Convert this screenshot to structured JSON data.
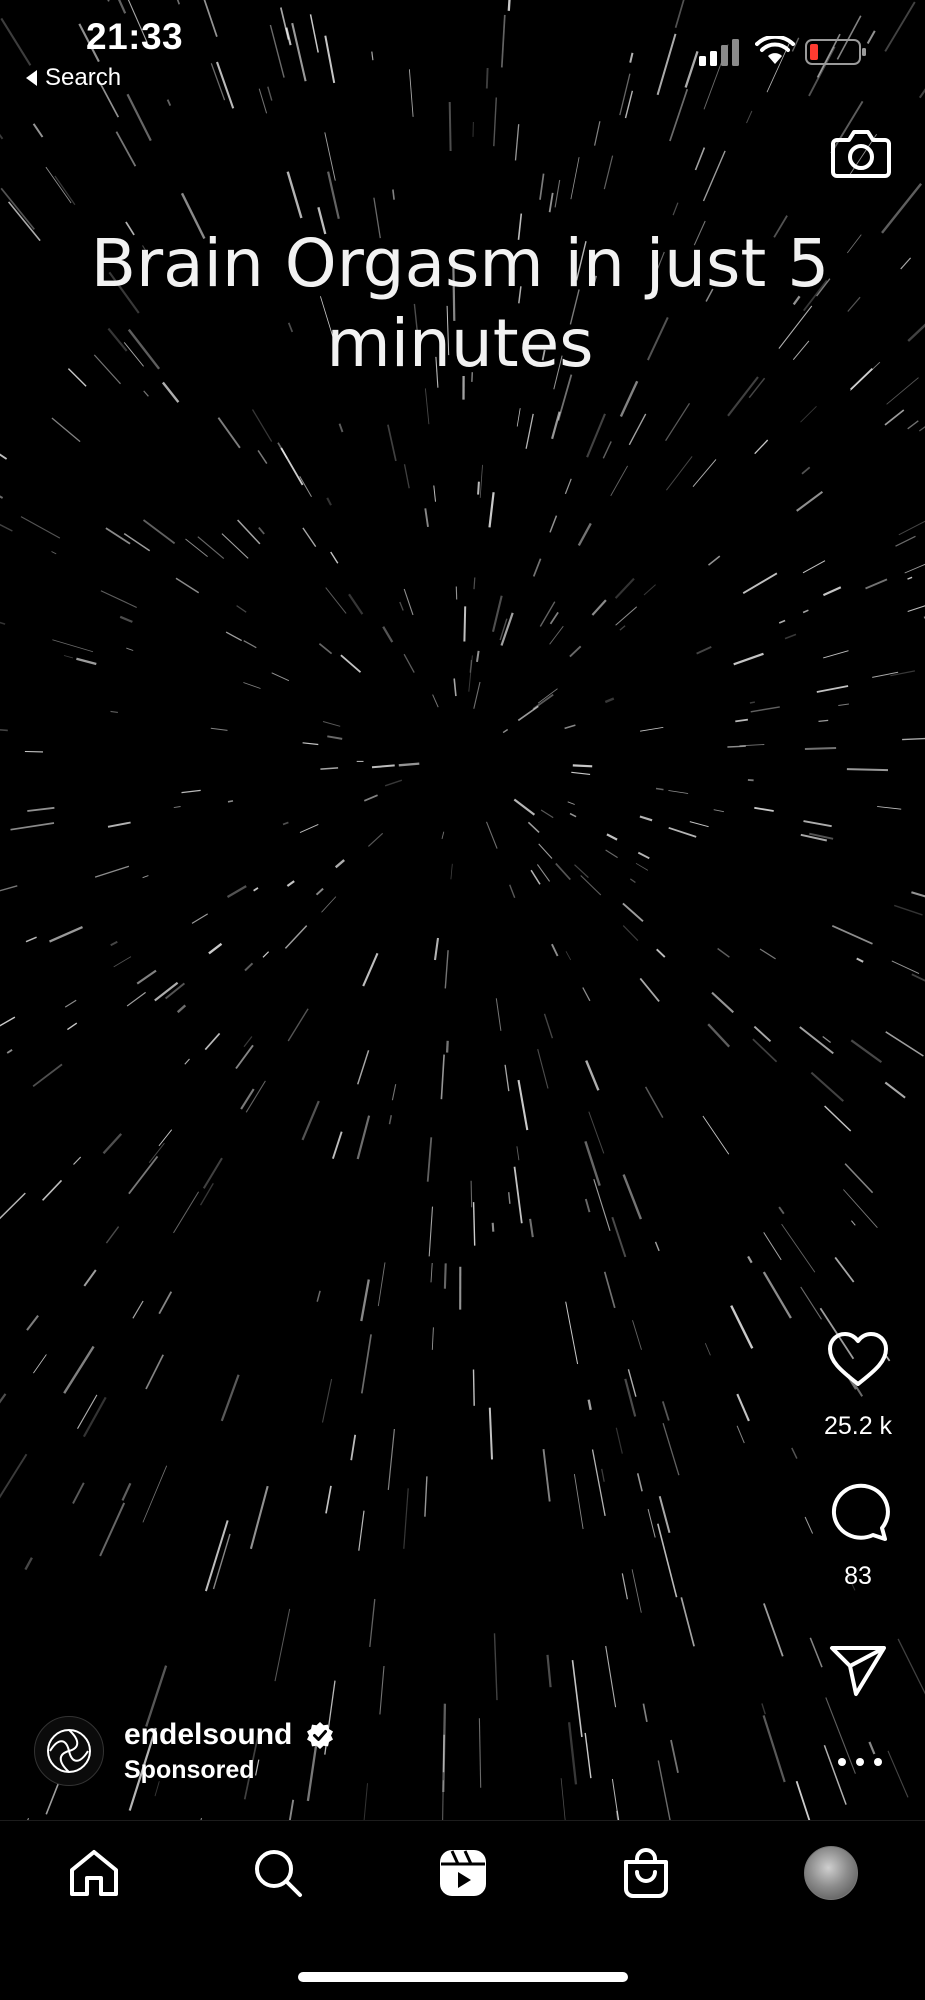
{
  "status_bar": {
    "time": "21:33",
    "back_label": "Search",
    "icons": [
      "cellular-signal-icon",
      "wifi-icon",
      "battery-low-icon"
    ]
  },
  "reel": {
    "headline": "Brain Orgasm in just 5 minutes",
    "account": {
      "username": "endelsound",
      "verified": true,
      "label": "Sponsored"
    },
    "actions": {
      "likes": "25.2 k",
      "comments": "83"
    }
  },
  "tab_bar": {
    "tabs": [
      "home-icon",
      "search-icon",
      "reels-icon",
      "shop-icon",
      "profile-icon"
    ],
    "active": "reels"
  },
  "colors": {
    "background": "#000000",
    "foreground": "#ffffff",
    "battery_low": "#ff3b30"
  }
}
